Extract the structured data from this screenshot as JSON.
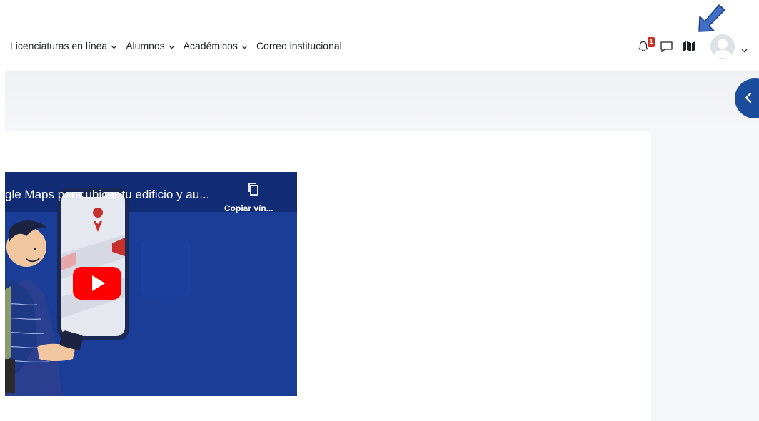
{
  "nav": {
    "items": [
      {
        "label": "Licenciaturas en línea",
        "has_dropdown": true
      },
      {
        "label": "Alumnos",
        "has_dropdown": true
      },
      {
        "label": "Académicos",
        "has_dropdown": true
      },
      {
        "label": "Correo institucional",
        "has_dropdown": false
      }
    ],
    "notifications_count": "1",
    "icons": [
      "bell-icon",
      "chat-icon",
      "map-icon",
      "user-avatar",
      "chevron-down-icon"
    ]
  },
  "video": {
    "title": "gle Maps para ubicar tu edificio y au...",
    "copy_link_label": "Copiar vín..."
  },
  "colors": {
    "accent": "#1c4c9c",
    "badge": "#ca3120",
    "video_bg": "#1a3e9a",
    "youtube_red": "#ff0000"
  }
}
